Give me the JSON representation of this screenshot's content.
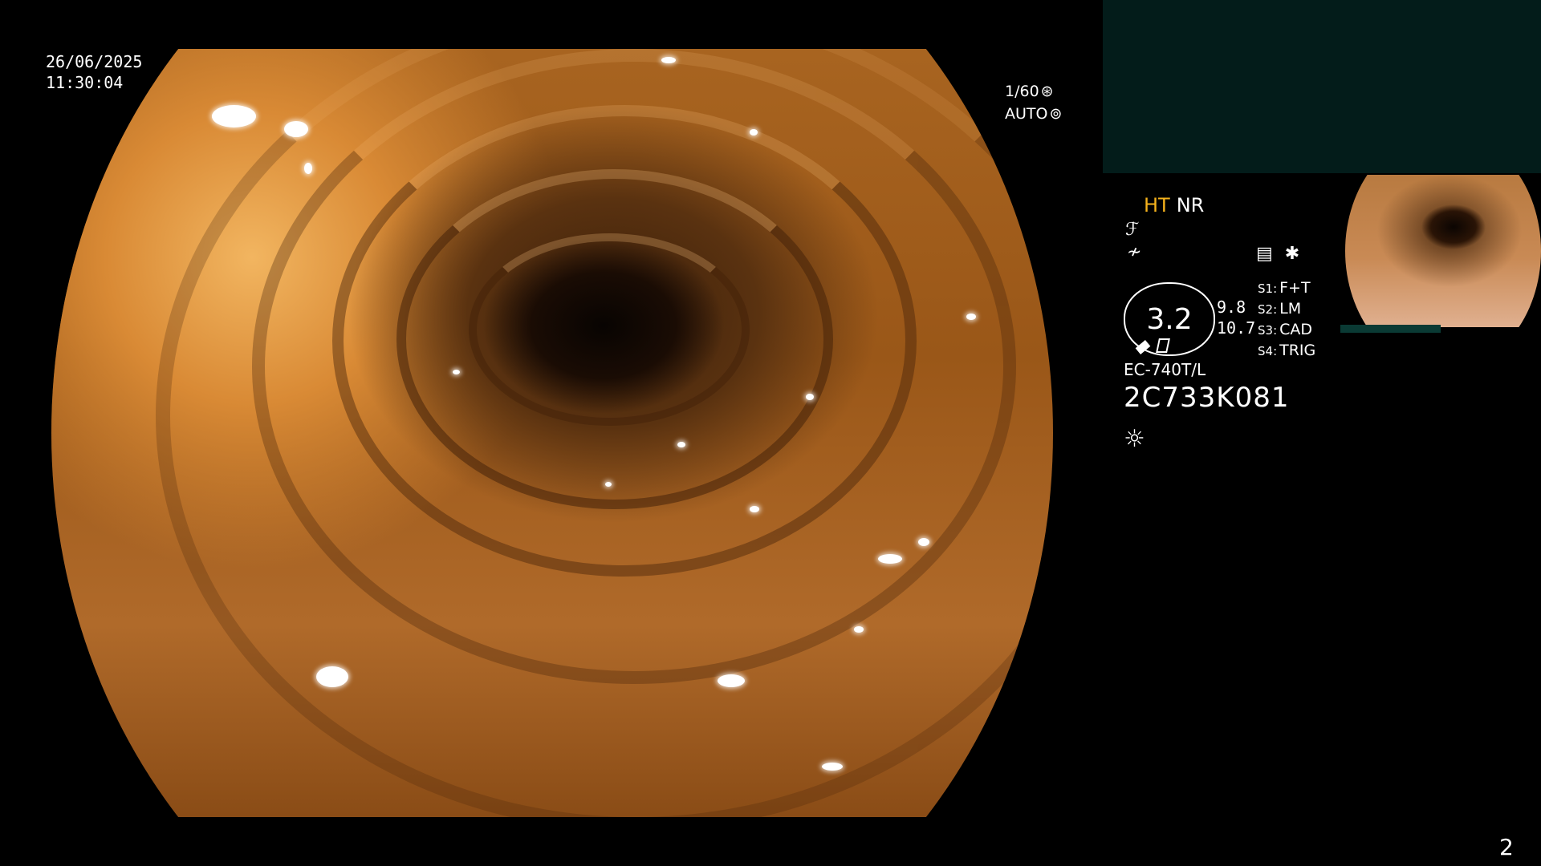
{
  "overlay": {
    "date": "26/06/2025",
    "time": "11:30:04",
    "shutter_speed": "1/60",
    "exposure_mode": "AUTO",
    "page_number": "2"
  },
  "panel": {
    "mode_ht": "HT",
    "mode_nr": "NR",
    "zoom_value": "3.2",
    "zoom_readout_1": "9.8",
    "zoom_readout_2": "10.7",
    "switches": [
      {
        "key": "S1:",
        "label": "F+T"
      },
      {
        "key": "S2:",
        "label": "LM"
      },
      {
        "key": "S3:",
        "label": "CAD"
      },
      {
        "key": "S4:",
        "label": "TRIG"
      }
    ],
    "scope_model": "EC-740T/L",
    "serial": "2C733K081"
  },
  "colors": {
    "ht_accent": "#f5b21c",
    "teal_panel": "#031c1a",
    "background": "#000000"
  },
  "icons": [
    "shutter-mode-icon",
    "auto-mode-icon",
    "structure-enhance-icon",
    "color-enhance-icon",
    "memo-icon",
    "asterisk-icon",
    "light-source-icon"
  ]
}
